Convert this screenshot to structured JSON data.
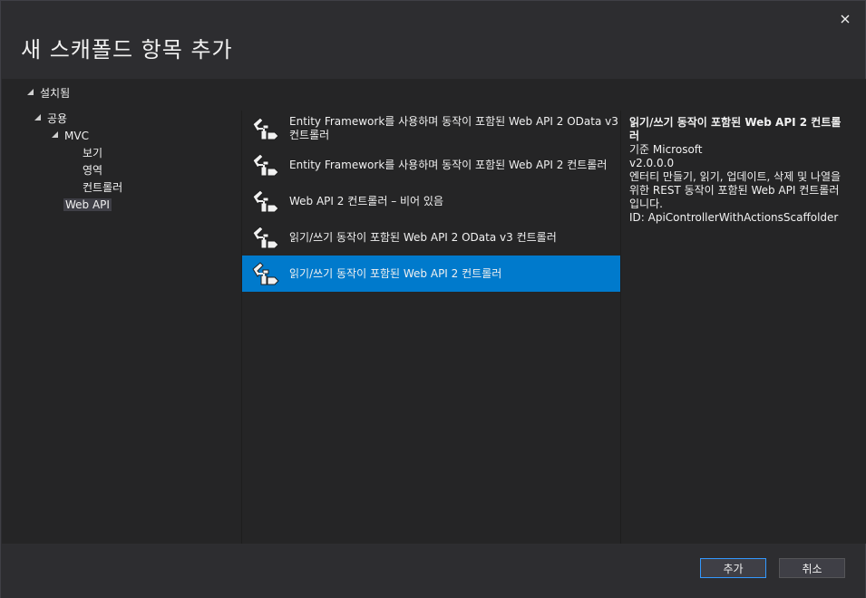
{
  "dialog": {
    "title": "새 스캐폴드 항목 추가",
    "close_icon": "close-icon"
  },
  "tree": {
    "installed": "설치됨",
    "common": "공용",
    "mvc": "MVC",
    "view": "보기",
    "area": "영역",
    "controller": "컨트롤러",
    "webapi": "Web API"
  },
  "list": {
    "items": [
      {
        "label": "Entity Framework를 사용하며 동작이 포함된 Web API 2 OData v3 컨트롤러",
        "icon": "scaffold-icon"
      },
      {
        "label": "Entity Framework를 사용하며 동작이 포함된 Web API 2 컨트롤러",
        "icon": "scaffold-icon"
      },
      {
        "label": "Web API 2 컨트롤러 – 비어 있음",
        "icon": "scaffold-icon"
      },
      {
        "label": "읽기/쓰기 동작이 포함된 Web API 2 OData v3 컨트롤러",
        "icon": "scaffold-icon"
      },
      {
        "label": "읽기/쓰기 동작이 포함된 Web API 2 컨트롤러",
        "icon": "scaffold-icon",
        "selected": true
      }
    ]
  },
  "detail": {
    "title": "읽기/쓰기 동작이 포함된 Web API 2 컨트롤러",
    "author": "기준 Microsoft",
    "version": "v2.0.0.0",
    "description": "엔터티 만들기, 읽기, 업데이트, 삭제 및 나열을 위한 REST 동작이 포함된 Web API 컨트롤러입니다.",
    "id": "ID: ApiControllerWithActionsScaffolder"
  },
  "footer": {
    "add_label": "추가",
    "cancel_label": "취소"
  },
  "colors": {
    "selection": "#007acc",
    "background": "#2d2d30",
    "panel": "#252526"
  }
}
